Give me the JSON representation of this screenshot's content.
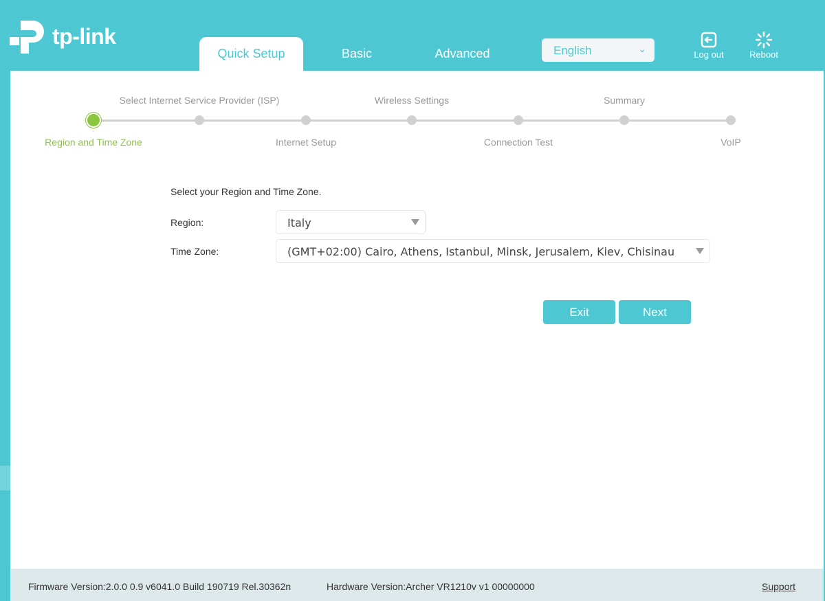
{
  "brand": {
    "name": "tp-link"
  },
  "header": {
    "tabs": [
      {
        "label": "Quick Setup",
        "active": true
      },
      {
        "label": "Basic"
      },
      {
        "label": "Advanced"
      }
    ],
    "language": {
      "selected": "English"
    },
    "logout": "Log out",
    "reboot": "Reboot"
  },
  "steps": [
    {
      "label": "Region and Time Zone",
      "position": "below",
      "active": true
    },
    {
      "label": "Select Internet Service Provider (ISP)",
      "position": "above"
    },
    {
      "label": "Internet Setup",
      "position": "below"
    },
    {
      "label": "Wireless Settings",
      "position": "above"
    },
    {
      "label": "Connection Test",
      "position": "below"
    },
    {
      "label": "Summary",
      "position": "above"
    },
    {
      "label": "VoIP",
      "position": "below"
    }
  ],
  "form": {
    "intro": "Select your Region and Time Zone.",
    "region_label": "Region:",
    "region_value": "Italy",
    "tz_label": "Time Zone:",
    "tz_value": "(GMT+02:00) Cairo, Athens, Istanbul, Minsk, Jerusalem, Kiev, Chisinau",
    "exit": "Exit",
    "next": "Next"
  },
  "footer": {
    "firmware": "Firmware Version:2.0.0 0.9 v6041.0 Build 190719 Rel.30362n",
    "hardware": "Hardware Version:Archer VR1210v v1 00000000",
    "support": "Support"
  },
  "colors": {
    "accent": "#4dc8d3",
    "active_step": "#8cc63f"
  }
}
